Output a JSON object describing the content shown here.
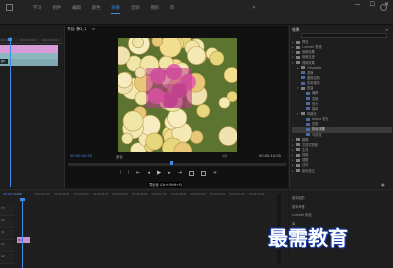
{
  "window": {
    "controls": [
      "—",
      "☐",
      "✕"
    ]
  },
  "menubar": {
    "tabs": [
      "学习",
      "组件",
      "编辑",
      "颜色",
      "效果",
      "音频",
      "图形",
      "库"
    ],
    "active_index": 4,
    "more": "»",
    "accent": "#3f8be6"
  },
  "program": {
    "tab_label": "节目: 静2_1",
    "menu": "≡",
    "timecode_left": "00:00:04:20",
    "fit": "适合",
    "resolution": "1/2",
    "timecode_right": "00:00:10:00",
    "tooltip": "导出帧 (Ctrl+Shift+E)"
  },
  "effects": {
    "title": "效果",
    "menu": "≡",
    "tree": [
      {
        "lvl": 0,
        "kind": "f",
        "open": false,
        "label": "预设"
      },
      {
        "lvl": 0,
        "kind": "f",
        "open": false,
        "label": "Lumetri 预设"
      },
      {
        "lvl": 0,
        "kind": "f",
        "open": false,
        "label": "音频效果"
      },
      {
        "lvl": 0,
        "kind": "f",
        "open": false,
        "label": "音频过渡"
      },
      {
        "lvl": 0,
        "kind": "f",
        "open": true,
        "label": "视频效果"
      },
      {
        "lvl": 1,
        "kind": "f",
        "open": false,
        "label": "Obsolete"
      },
      {
        "lvl": 1,
        "kind": "e",
        "open": false,
        "label": "变换"
      },
      {
        "lvl": 1,
        "kind": "e",
        "open": false,
        "label": "图像控制"
      },
      {
        "lvl": 1,
        "kind": "e",
        "open": false,
        "label": "实用程序"
      },
      {
        "lvl": 1,
        "kind": "f",
        "open": true,
        "label": "扭曲"
      },
      {
        "lvl": 2,
        "kind": "e",
        "open": false,
        "label": "偏移"
      },
      {
        "lvl": 2,
        "kind": "e",
        "open": false,
        "label": "变换"
      },
      {
        "lvl": 2,
        "kind": "e",
        "open": false,
        "label": "放大"
      },
      {
        "lvl": 2,
        "kind": "e",
        "open": false,
        "label": "旋转"
      },
      {
        "lvl": 1,
        "kind": "f",
        "open": true,
        "label": "风格化"
      },
      {
        "lvl": 2,
        "kind": "e",
        "open": false,
        "label": "Alpha 发光"
      },
      {
        "lvl": 2,
        "kind": "e",
        "open": false,
        "label": "复制"
      },
      {
        "lvl": 2,
        "kind": "e",
        "open": false,
        "label": "彩色浮雕",
        "sel": true
      },
      {
        "lvl": 2,
        "kind": "e",
        "open": false,
        "label": "马赛克"
      },
      {
        "lvl": 0,
        "kind": "f",
        "open": false,
        "label": "模糊"
      },
      {
        "lvl": 0,
        "kind": "f",
        "open": false,
        "label": "沉浸式视频"
      },
      {
        "lvl": 0,
        "kind": "f",
        "open": false,
        "label": "生成"
      },
      {
        "lvl": 0,
        "kind": "f",
        "open": false,
        "label": "视频"
      },
      {
        "lvl": 0,
        "kind": "f",
        "open": false,
        "label": "调整"
      },
      {
        "lvl": 0,
        "kind": "f",
        "open": false,
        "label": "过时"
      },
      {
        "lvl": 0,
        "kind": "f",
        "open": false,
        "label": "颜色校正"
      }
    ]
  },
  "essential": {
    "items": [
      "基本图形",
      "基本声音",
      "Lumetri 颜色",
      "库"
    ]
  },
  "source": {
    "ruler": [
      "00:00",
      "00:00:05:00",
      "00:00:10:00"
    ],
    "clip_label": "静2"
  },
  "timeline": {
    "timecode": "00:00:04:20",
    "ruler": [
      "00:00",
      "00:00:01:00",
      "00:00:02:00",
      "00:00:03:00",
      "00:00:04:00",
      "00:00:05:00",
      "00:00:06:00",
      "00:00:07:00",
      "00:00:08:00",
      "00:00:09:00",
      "00:00:10:00",
      "00:00:11:00",
      "00:00:12:00"
    ],
    "tracks": [
      "V3",
      "V2",
      "V1",
      "A1",
      "A2"
    ],
    "clip_label": "静2"
  },
  "watermark": {
    "text": "最需教育"
  }
}
